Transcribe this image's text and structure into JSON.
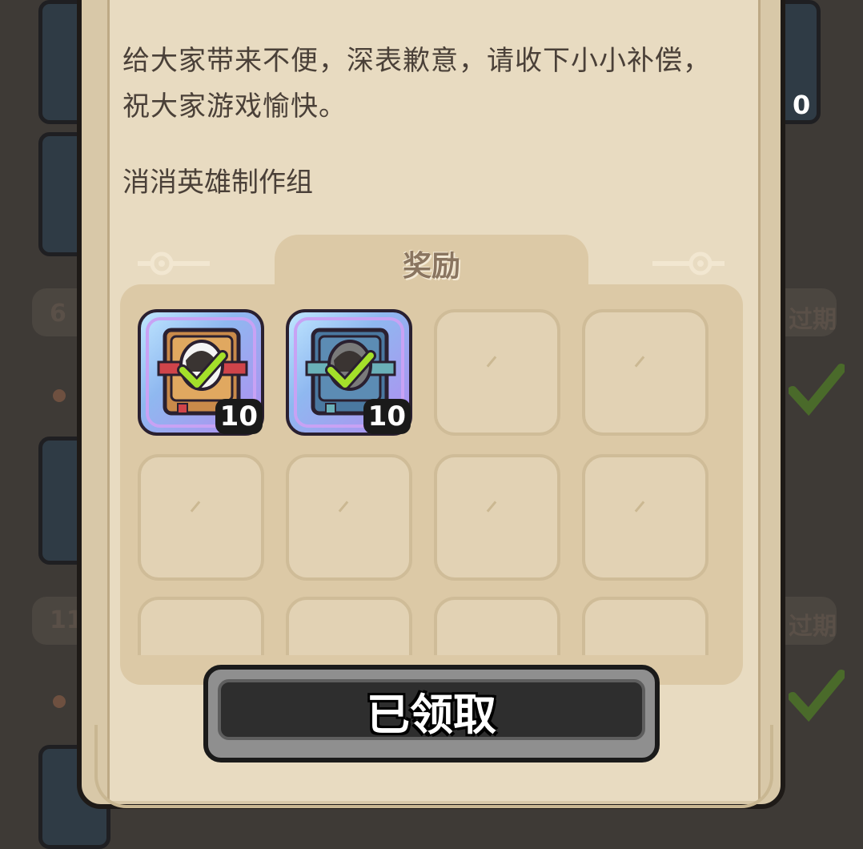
{
  "background": {
    "left_labels": [
      "6",
      "11"
    ],
    "right_labels": [
      "过期",
      "过期"
    ],
    "right_badge": "0"
  },
  "mail": {
    "body": "给大家带来不便，深表歉意，请收下小小补偿，祝大家游戏愉快。",
    "signature": "消消英雄制作组"
  },
  "rewards": {
    "title": "奖励",
    "items": [
      {
        "icon": "orange-book-check-icon",
        "count": "10"
      },
      {
        "icon": "blue-book-check-icon",
        "count": "10"
      }
    ],
    "empty_slots": 10
  },
  "claim_button": {
    "label": "已领取",
    "state": "claimed"
  },
  "colors": {
    "parchment": "#e8dbc1",
    "panel": "#dcc9a6",
    "check_green": "#a4e02a",
    "button_dark": "#2e2e2e"
  }
}
